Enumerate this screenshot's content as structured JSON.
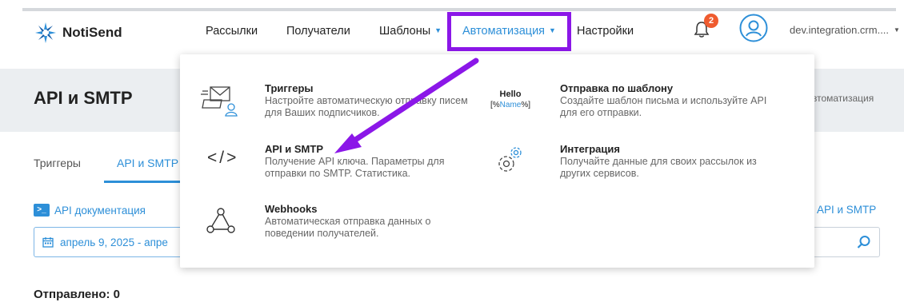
{
  "brand": {
    "name": "NotiSend"
  },
  "nav": {
    "items": [
      {
        "label": "Рассылки"
      },
      {
        "label": "Получатели"
      },
      {
        "label": "Шаблоны"
      },
      {
        "label": "Автоматизация"
      },
      {
        "label": "Настройки"
      }
    ],
    "notifications_count": "2",
    "account": "dev.integration.crm...."
  },
  "page": {
    "title": "API и SMTP",
    "breadcrumb_tail": "втоматизация"
  },
  "tabs": [
    {
      "label": "Триггеры"
    },
    {
      "label": "API и SMTP"
    }
  ],
  "main": {
    "api_doc_link": "API документация",
    "api_doc_icon": ">_",
    "right_link": "API и SMTP",
    "date_range": "апрель 9, 2025 - апре",
    "sent_label": "Отправлено: 0"
  },
  "dropdown": {
    "items": [
      {
        "title": "Триггеры",
        "desc": "Настройте автоматическую отправку писем для Ваших подписчиков.",
        "icon": "envelope-user-icon"
      },
      {
        "title": "Отправка по шаблону",
        "desc": "Создайте шаблон письма и используйте API для его отправки.",
        "icon": "hello-template-icon"
      },
      {
        "title": "API и SMTP",
        "desc": "Получение API ключа. Параметры для отправки по SMTP. Статистика.",
        "icon": "code-icon"
      },
      {
        "title": "Интеграция",
        "desc": "Получайте данные для своих рассылок из других сервисов.",
        "icon": "gears-icon"
      },
      {
        "title": "Webhooks",
        "desc": "Автоматическая отправка данных о поведении получателей.",
        "icon": "webhook-icon"
      }
    ],
    "hello": {
      "line1": "Hello",
      "pre": "[%",
      "name": "Name",
      "post": "%]"
    },
    "code_glyph": "</>"
  },
  "colors": {
    "accent": "#2d8fd8",
    "highlight": "#8b17e8",
    "badge": "#ef5b2f",
    "band": "#ebeef1"
  }
}
